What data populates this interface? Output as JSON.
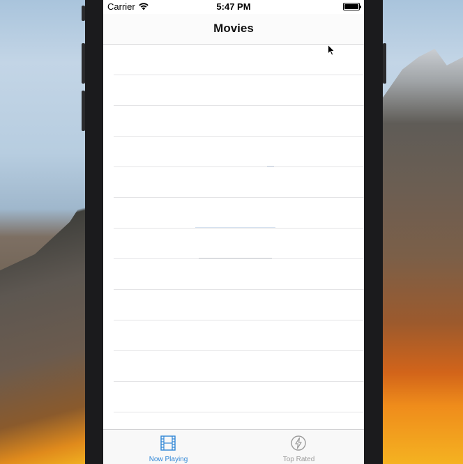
{
  "status_bar": {
    "carrier": "Carrier",
    "time": "5:47 PM",
    "icons": [
      "wifi-icon",
      "battery-icon"
    ]
  },
  "nav_bar": {
    "title": "Movies"
  },
  "table": {
    "row_count": 12
  },
  "tab_bar": {
    "tabs": [
      {
        "label": "Now Playing",
        "icon": "film-icon",
        "selected": true,
        "color": "#2f86d6"
      },
      {
        "label": "Top Rated",
        "icon": "lightning-icon",
        "selected": false,
        "color": "#9b9b9b"
      }
    ]
  },
  "colors": {
    "accent": "#2f86d6",
    "inactive": "#9b9b9b",
    "separator": "#e4e4e6"
  }
}
